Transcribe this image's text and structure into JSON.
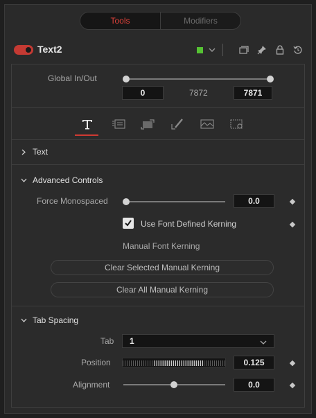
{
  "top_tabs": {
    "tools": "Tools",
    "modifiers": "Modifiers"
  },
  "header": {
    "title": "Text2",
    "color_swatch": "#55c233"
  },
  "global_inout": {
    "label": "Global In/Out",
    "in_value": "0",
    "middle_value": "7872",
    "out_value": "7871"
  },
  "icon_tabs": [
    "text-tab",
    "layout-tab",
    "transform-tab",
    "shading-tab",
    "image-tab",
    "settings-tab"
  ],
  "sections": {
    "text": {
      "label": "Text"
    },
    "advanced": {
      "label": "Advanced Controls",
      "force_monospaced_label": "Force Monospaced",
      "force_monospaced_value": "0.0",
      "use_font_kerning_label": "Use Font Defined Kerning",
      "manual_kerning_label": "Manual Font Kerning",
      "clear_selected_label": "Clear Selected Manual Kerning",
      "clear_all_label": "Clear All Manual Kerning"
    },
    "tab_spacing": {
      "label": "Tab Spacing",
      "tab_label": "Tab",
      "tab_value": "1",
      "position_label": "Position",
      "position_value": "0.125",
      "alignment_label": "Alignment",
      "alignment_value": "0.0"
    }
  },
  "colors": {
    "accent": "#d03a32",
    "active_tab_text": "#e0423a"
  }
}
